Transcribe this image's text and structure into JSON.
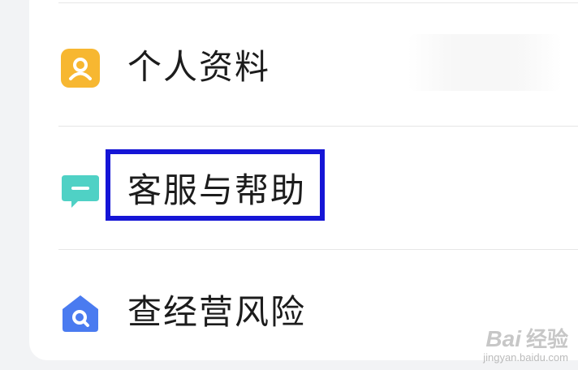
{
  "menu": {
    "items": [
      {
        "label": "个人资料",
        "icon": "profile-icon",
        "icon_color": "#f7b731"
      },
      {
        "label": "客服与帮助",
        "icon": "chat-bubble-icon",
        "icon_color": "#4fd1c5"
      },
      {
        "label": "查经营风险",
        "icon": "house-search-icon",
        "icon_color": "#4a7bf0"
      }
    ]
  },
  "highlight": {
    "color": "#1515d6",
    "target": "客服与帮助"
  },
  "watermark": {
    "brand": "Bai",
    "brand_suffix": "经验",
    "url": "jingyan.baidu.com"
  }
}
